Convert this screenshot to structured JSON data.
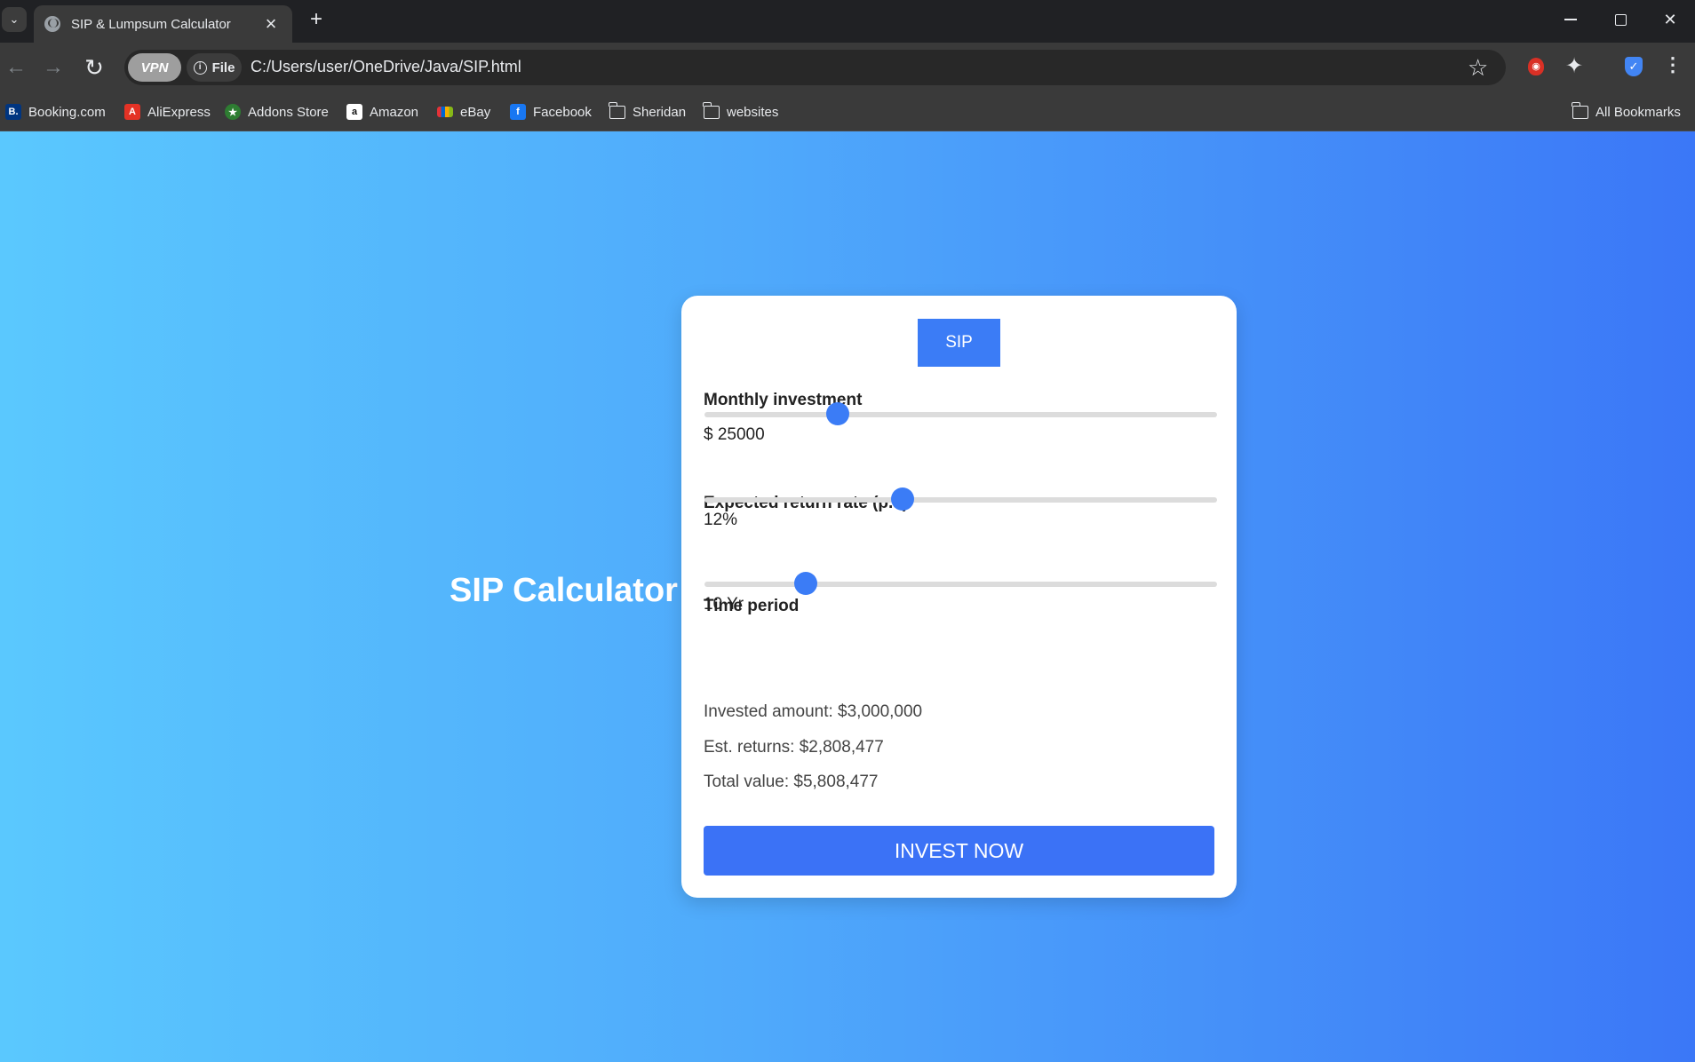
{
  "browser": {
    "tab_title": "SIP & Lumpsum Calculator",
    "new_tab_symbol": "+",
    "url": "C:/Users/user/OneDrive/Java/SIP.html",
    "scheme_chip": "File",
    "vpn_label": "VPN",
    "bookmarks": [
      {
        "label": "Booking.com",
        "icon": "booking-icon",
        "badge": "B.",
        "color": "#003580"
      },
      {
        "label": "AliExpress",
        "icon": "aliexpress-icon",
        "badge": "A",
        "color": "#e43225"
      },
      {
        "label": "Addons Store",
        "icon": "addons-store-icon",
        "badge": "★",
        "color": "#2e7d32"
      },
      {
        "label": "Amazon",
        "icon": "amazon-icon",
        "badge": "a",
        "color": "#ffffff"
      },
      {
        "label": "eBay",
        "icon": "ebay-icon",
        "badge": "",
        "color": "#e53238"
      },
      {
        "label": "Facebook",
        "icon": "facebook-icon",
        "badge": "f",
        "color": "#1877f2"
      },
      {
        "label": "Sheridan",
        "icon": "folder-icon"
      },
      {
        "label": "websites",
        "icon": "folder-icon"
      }
    ],
    "all_bookmarks": "All Bookmarks"
  },
  "page": {
    "heading": "SIP Calculator",
    "mode_tab": "SIP",
    "fields": [
      {
        "label": "Monthly investment",
        "value": "$ 25000",
        "slider_fraction": 0.26
      },
      {
        "label": "Expected return rate (p.a)",
        "value": "12%",
        "slider_fraction": 0.386
      },
      {
        "label": "Time period",
        "value": "10 Yr",
        "slider_fraction": 0.197
      }
    ],
    "results": {
      "invested": "Invested amount: $3,000,000",
      "returns": "Est. returns: $2,808,477",
      "total": "Total value: $5,808,477"
    },
    "cta": "INVEST NOW"
  },
  "colors": {
    "accent": "#3b7cf6",
    "gradient_start": "#5ac8fe",
    "gradient_end": "#3b77f7"
  }
}
